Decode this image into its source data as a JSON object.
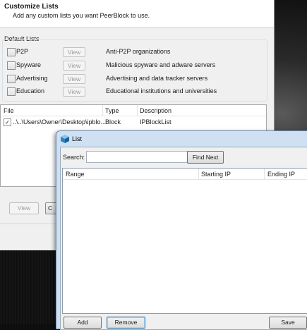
{
  "main_window": {
    "title": "Customize Lists",
    "subtitle": "Add any custom lists you want PeerBlock to use.",
    "default_lists_label": "Default Lists",
    "default_lists": [
      {
        "name": "P2P",
        "view_label": "View",
        "description": "Anti-P2P organizations"
      },
      {
        "name": "Spyware",
        "view_label": "View",
        "description": "Malicious spyware and adware servers"
      },
      {
        "name": "Advertising",
        "view_label": "View",
        "description": "Advertising and data tracker servers"
      },
      {
        "name": "Education",
        "view_label": "View",
        "description": "Educational institutions and universities"
      }
    ],
    "file_list": {
      "columns": [
        "File",
        "Type",
        "Description"
      ],
      "rows": [
        {
          "checked_mark": "✓",
          "file": "..\\..\\Users\\Owner\\Desktop\\ipblo...",
          "type": "Block",
          "description": "IPBlockList"
        }
      ]
    },
    "view_button": "View",
    "partial_button": "C"
  },
  "list_dialog": {
    "title": "List",
    "search_label": "Search:",
    "search_value": "",
    "find_next_label": "Find Next",
    "columns": [
      "Range",
      "Starting IP",
      "Ending IP"
    ],
    "add_label": "Add",
    "remove_label": "Remove",
    "save_label": "Save"
  },
  "colors": {
    "accent_border": "#3c7fb1",
    "dialog_frame": "#cfe0f2"
  }
}
